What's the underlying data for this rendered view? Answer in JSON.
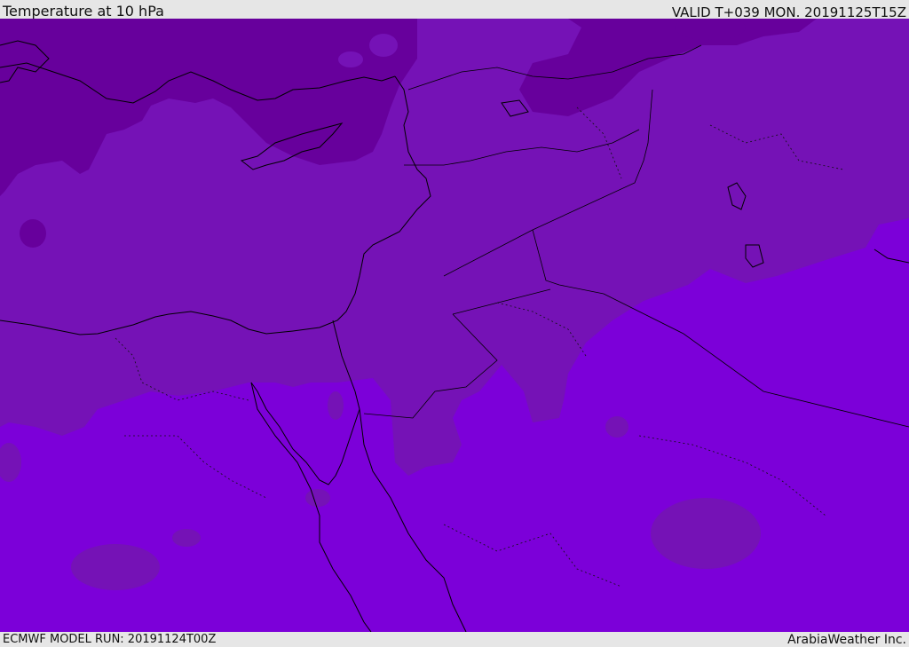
{
  "header": {
    "title": "Temperature at 10 hPa",
    "valid_time": "VALID T+039 MON. 20191125T15Z"
  },
  "footer": {
    "model_run": "ECMWF MODEL RUN: 20191124T00Z",
    "credit": "ArabiaWeather Inc."
  },
  "colors": {
    "band_coldest": "#67009c",
    "band_cold": "#7512b6",
    "band_mid": "#7c00d9",
    "band_patch": "#7a16b8",
    "coastline": "#000000",
    "frame": "#e6e6e6"
  }
}
